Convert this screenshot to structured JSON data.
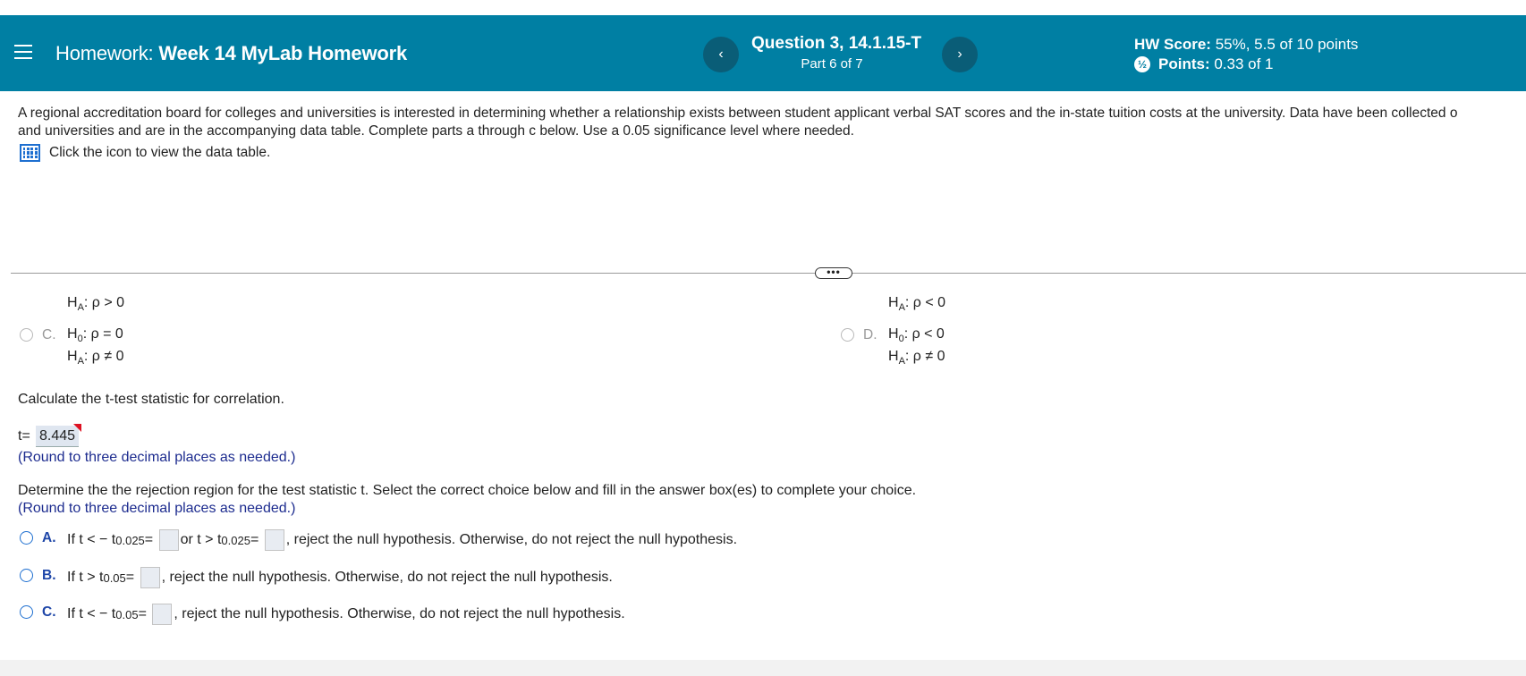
{
  "header": {
    "homework_prefix": "Homework:",
    "homework_name": "Week 14 MyLab Homework",
    "question_title": "Question 3, 14.1.15-T",
    "question_part": "Part 6 of 7",
    "prev_glyph": "‹",
    "next_glyph": "›",
    "hw_score_label": "HW Score:",
    "hw_score_value": "55%, 5.5 of 10 points",
    "points_label": "Points:",
    "points_value": "0.33 of 1",
    "colors": {
      "bar": "#007fa3",
      "nav_button": "#0a5d77"
    }
  },
  "intro": {
    "line1": "A regional accreditation board for colleges and universities is interested in determining whether a relationship exists between student applicant verbal SAT scores and the in-state tuition costs at the university. Data have been collected o",
    "line2": "and universities and are in the accompanying data table. Complete parts a through c below. Use a 0.05 significance level where needed.",
    "data_link": "Click the icon to view the data table."
  },
  "divider": {
    "handle": "•••"
  },
  "prev_hypotheses": {
    "b_ha": "H",
    "b_ha_sub": "A",
    "b_ha_rest": ": ρ > 0",
    "e_ha_rest": ": ρ < 0",
    "c_letter": "C.",
    "c_h0": ": ρ = 0",
    "c_ha": ": ρ ≠ 0",
    "d_letter": "D.",
    "d_h0": ": ρ < 0",
    "d_ha": ": ρ ≠ 0",
    "h0_sub": "0",
    "h_letter": "H"
  },
  "t_stat": {
    "prompt": "Calculate the t-test statistic for correlation.",
    "label": "t=",
    "value": "8.445",
    "round_note": "(Round to three decimal places as needed.)"
  },
  "rejection": {
    "prompt": "Determine the the rejection region for the test statistic t. Select the correct choice below and fill in the answer box(es) to complete your choice.",
    "round_note": "(Round to three decimal places as needed.)",
    "choices": [
      {
        "letter": "A.",
        "p1": "If t < − t",
        "s1": "0.025",
        "p2": " =",
        "p3": " or t > t",
        "s2": "0.025",
        "p4": " =",
        "p5": ", reject the null hypothesis. Otherwise, do not reject the null hypothesis."
      },
      {
        "letter": "B.",
        "p1": "If t > t",
        "s1": "0.05",
        "p2": " =",
        "p5": ", reject the null hypothesis. Otherwise, do not reject the null hypothesis."
      },
      {
        "letter": "C.",
        "p1": "If t < − t",
        "s1": "0.05",
        "p2": " =",
        "p5": ", reject the null hypothesis. Otherwise, do not reject the null hypothesis."
      }
    ]
  }
}
